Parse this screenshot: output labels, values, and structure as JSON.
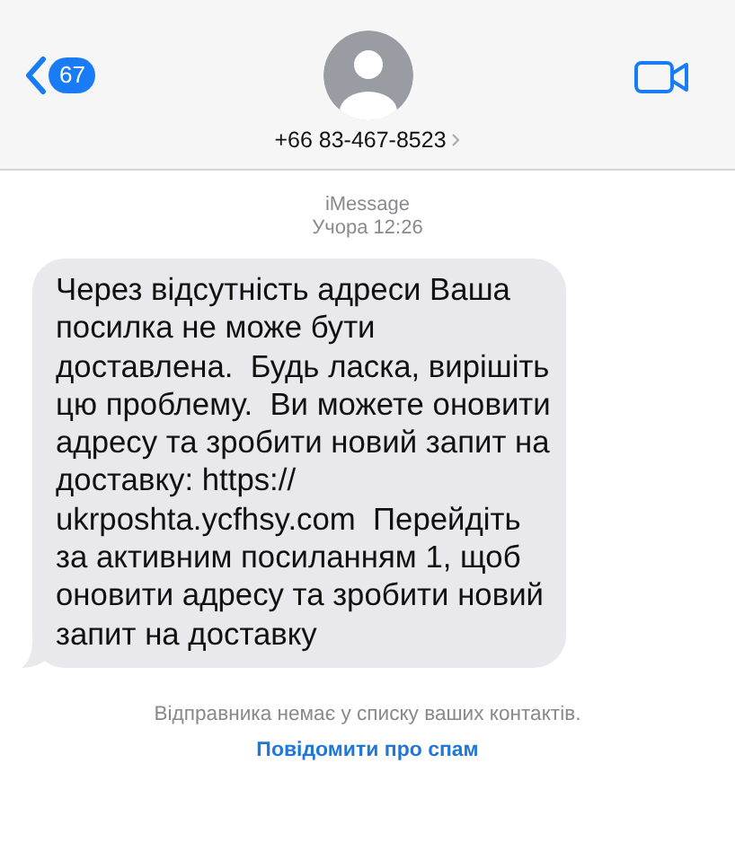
{
  "header": {
    "back_badge": "67",
    "contact": "+66 83-467-8523"
  },
  "thread": {
    "service": "iMessage",
    "timestamp": "Учора 12:26"
  },
  "messages": [
    {
      "kind": "incoming",
      "text": "Через відсутність адреси Ваша посилка не може бути доставлена.  Будь ласка, вирішіть цю проблему.  Ви можете оновити адресу та зробити новий запит на доставку: https:// ukrposhta.ycfhsy.com  Перейдіть за активним посиланням 1, щоб оновити адресу та зробити новий запит на доставку"
    }
  ],
  "notice": "Відправника немає у списку ваших контактів.",
  "report_link": "Повідомити про спам"
}
